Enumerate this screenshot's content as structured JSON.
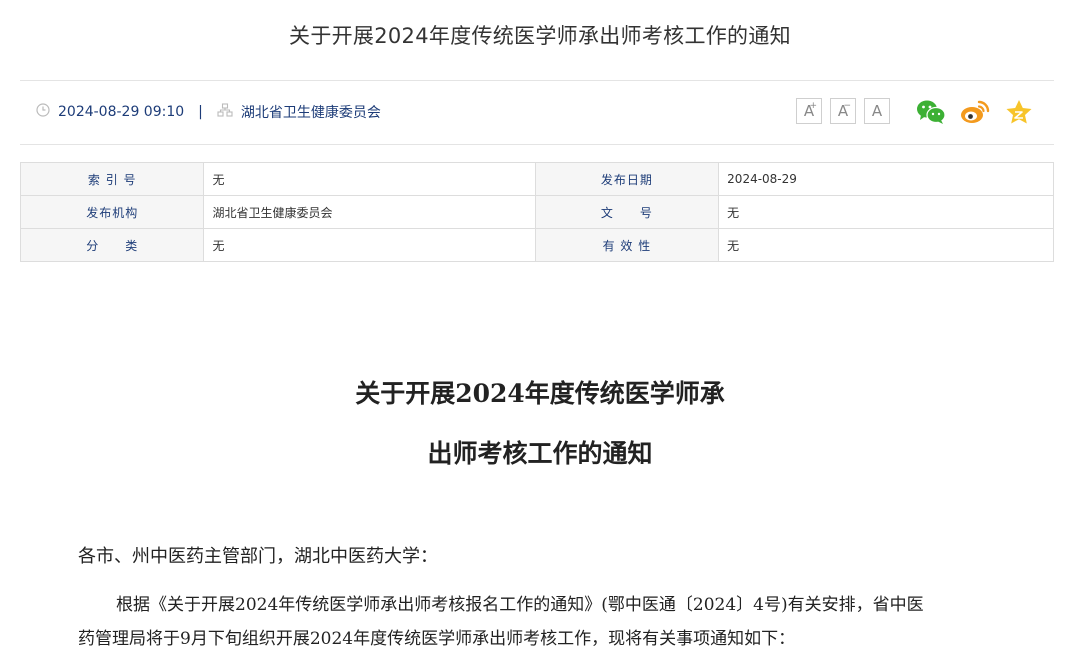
{
  "header": {
    "title": "关于开展2024年度传统医学师承出师考核工作的通知"
  },
  "meta": {
    "datetime": "2024-08-29 09:10",
    "separator": "|",
    "publisher": "湖北省卫生健康委员会"
  },
  "font_controls": {
    "increase": "A",
    "decrease": "A",
    "reset": "A"
  },
  "share": {
    "icons": [
      "wechat-icon",
      "weibo-icon",
      "favorite-star-icon"
    ]
  },
  "info_table": {
    "rows": [
      {
        "k1": "索 引 号",
        "v1": "无",
        "k2": "发布日期",
        "v2": "2024-08-29"
      },
      {
        "k1": "发布机构",
        "v1": "湖北省卫生健康委员会",
        "k2": "文　　号",
        "v2": "无"
      },
      {
        "k1": "分　　类",
        "v1": "无",
        "k2": "有 效 性",
        "v2": "无"
      }
    ]
  },
  "article": {
    "title_line1": "关于开展2024年度传统医学师承",
    "title_line2": "出师考核工作的通知",
    "salutation": "各市、州中医药主管部门，湖北中医药大学：",
    "para1_line1": "根据《关于开展2024年传统医学师承出师考核报名工作的通知》(鄂中医通〔2024〕4号)有关安排，省中医",
    "para1_line2": "药管理局将于9月下旬组织开展2024年度传统医学师承出师考核工作，现将有关事项通知如下："
  },
  "colors": {
    "link_blue": "#1d3c78",
    "wechat_green": "#3cb034",
    "weibo_orange": "#f39a1e",
    "star_yellow": "#f7c42a"
  }
}
